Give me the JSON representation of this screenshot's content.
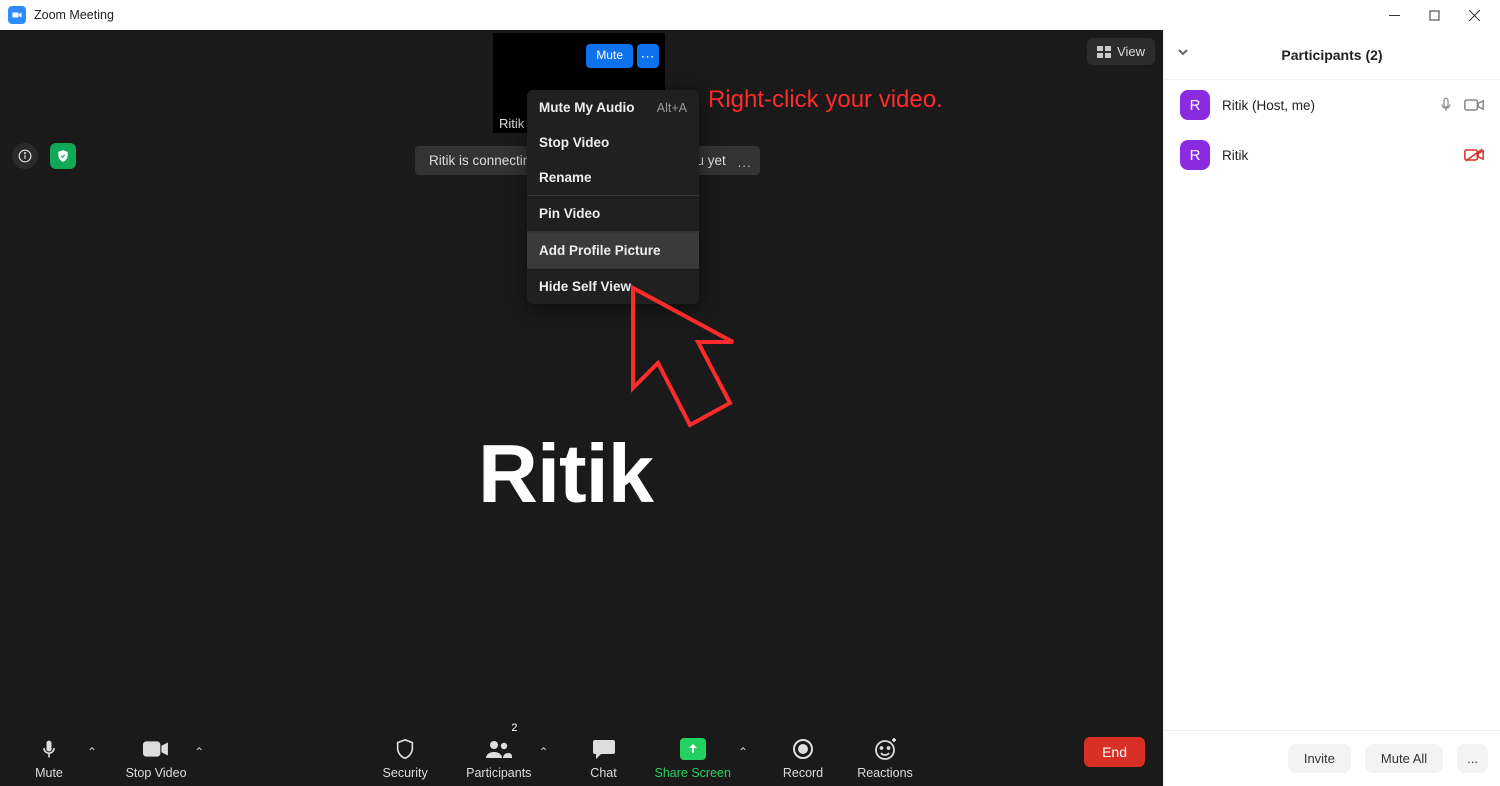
{
  "titlebar": {
    "title": "Zoom Meeting"
  },
  "self_thumb": {
    "mute_label": "Mute",
    "name": "Ritik"
  },
  "status_msg": "Ritik is connecting to audio and can't hear you yet",
  "annotation": "Right-click your video.",
  "view_label": "View",
  "main_name": "Ritik",
  "context_menu": {
    "items": [
      {
        "label": "Mute My Audio",
        "shortcut": "Alt+A"
      },
      {
        "label": "Stop Video"
      },
      {
        "label": "Rename"
      },
      {
        "label": "Pin Video"
      },
      {
        "label": "Add Profile Picture",
        "hovered": true
      },
      {
        "label": "Hide Self View"
      }
    ]
  },
  "toolbar": {
    "mute": "Mute",
    "stop_video": "Stop Video",
    "security": "Security",
    "participants": "Participants",
    "participants_count": "2",
    "chat": "Chat",
    "share": "Share Screen",
    "record": "Record",
    "reactions": "Reactions",
    "end": "End"
  },
  "participants_panel": {
    "title": "Participants (2)",
    "items": [
      {
        "initial": "R",
        "name": "Ritik (Host, me)",
        "mic": true,
        "cam": true,
        "cam_off": false
      },
      {
        "initial": "R",
        "name": "Ritik",
        "mic": false,
        "cam": true,
        "cam_off": true
      }
    ],
    "invite": "Invite",
    "mute_all": "Mute All",
    "more": "..."
  }
}
